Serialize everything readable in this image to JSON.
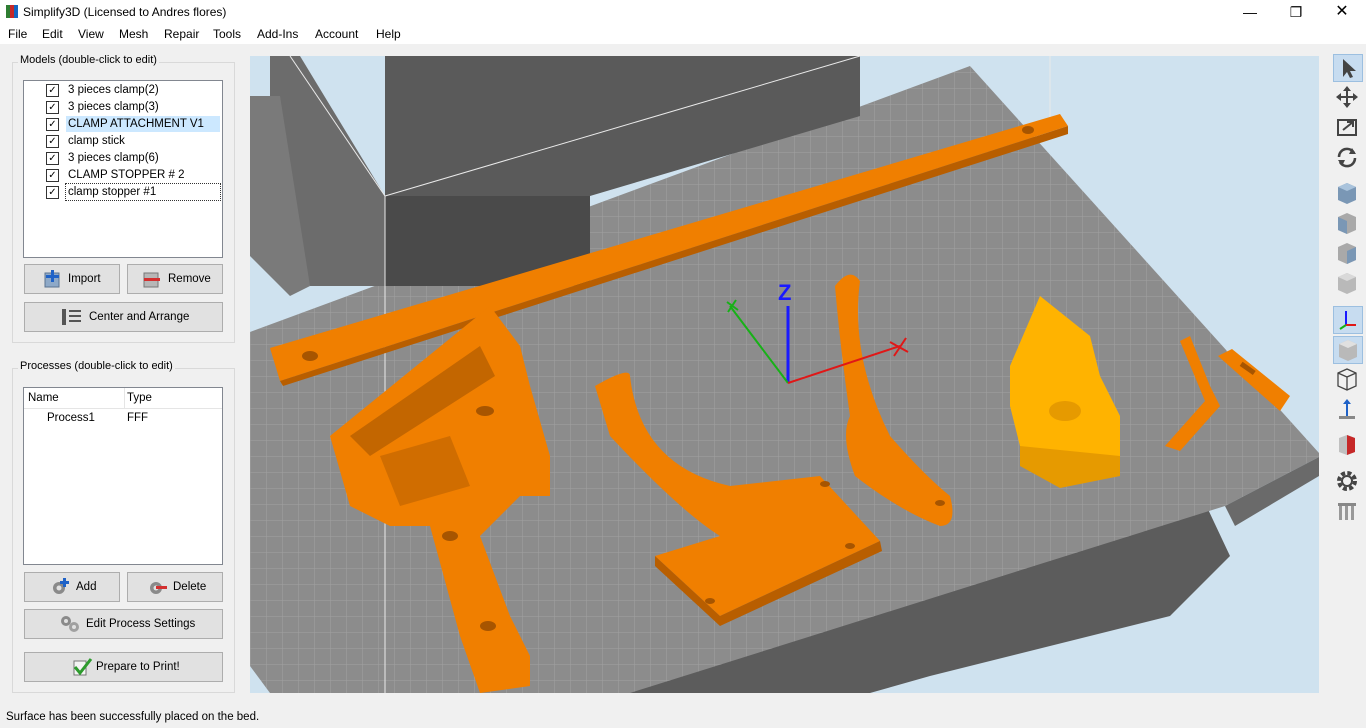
{
  "window": {
    "title": "Simplify3D (Licensed to Andres flores)",
    "minimize": "—",
    "maximize": "❐",
    "close": "✕"
  },
  "menu": [
    "File",
    "Edit",
    "View",
    "Mesh",
    "Repair",
    "Tools",
    "Add-Ins",
    "Account",
    "Help"
  ],
  "models_panel": {
    "title": "Models (double-click to edit)",
    "items": [
      {
        "label": "3 pieces clamp(2)",
        "checked": true
      },
      {
        "label": "3 pieces clamp(3)",
        "checked": true
      },
      {
        "label": "CLAMP ATTACHMENT V1",
        "checked": true
      },
      {
        "label": "clamp stick",
        "checked": true
      },
      {
        "label": "3 pieces clamp(6)",
        "checked": true
      },
      {
        "label": "CLAMP STOPPER # 2",
        "checked": true
      },
      {
        "label": "clamp stopper #1",
        "checked": true
      }
    ],
    "import_label": "Import",
    "remove_label": "Remove",
    "center_label": "Center and Arrange"
  },
  "processes_panel": {
    "title": "Processes (double-click to edit)",
    "columns": [
      "Name",
      "Type"
    ],
    "rows": [
      {
        "name": "Process1",
        "type": "FFF"
      }
    ],
    "add_label": "Add",
    "delete_label": "Delete",
    "edit_label": "Edit Process Settings"
  },
  "prepare_label": "Prepare to Print!",
  "viewport": {
    "axis_z_label": "Z",
    "model_color": "#f07f00",
    "selected_model_color": "#ffb300"
  },
  "toolbar_icons": [
    "select-icon",
    "move-icon",
    "scale-icon",
    "rotate-icon",
    "view-top-icon",
    "view-front-icon",
    "view-side-icon",
    "view-iso-icon",
    "axes-icon",
    "solid-view-icon",
    "wireframe-view-icon",
    "normals-icon",
    "section-icon",
    "settings-gear-icon",
    "supports-icon"
  ],
  "status": "Surface has been successfully placed on the bed."
}
